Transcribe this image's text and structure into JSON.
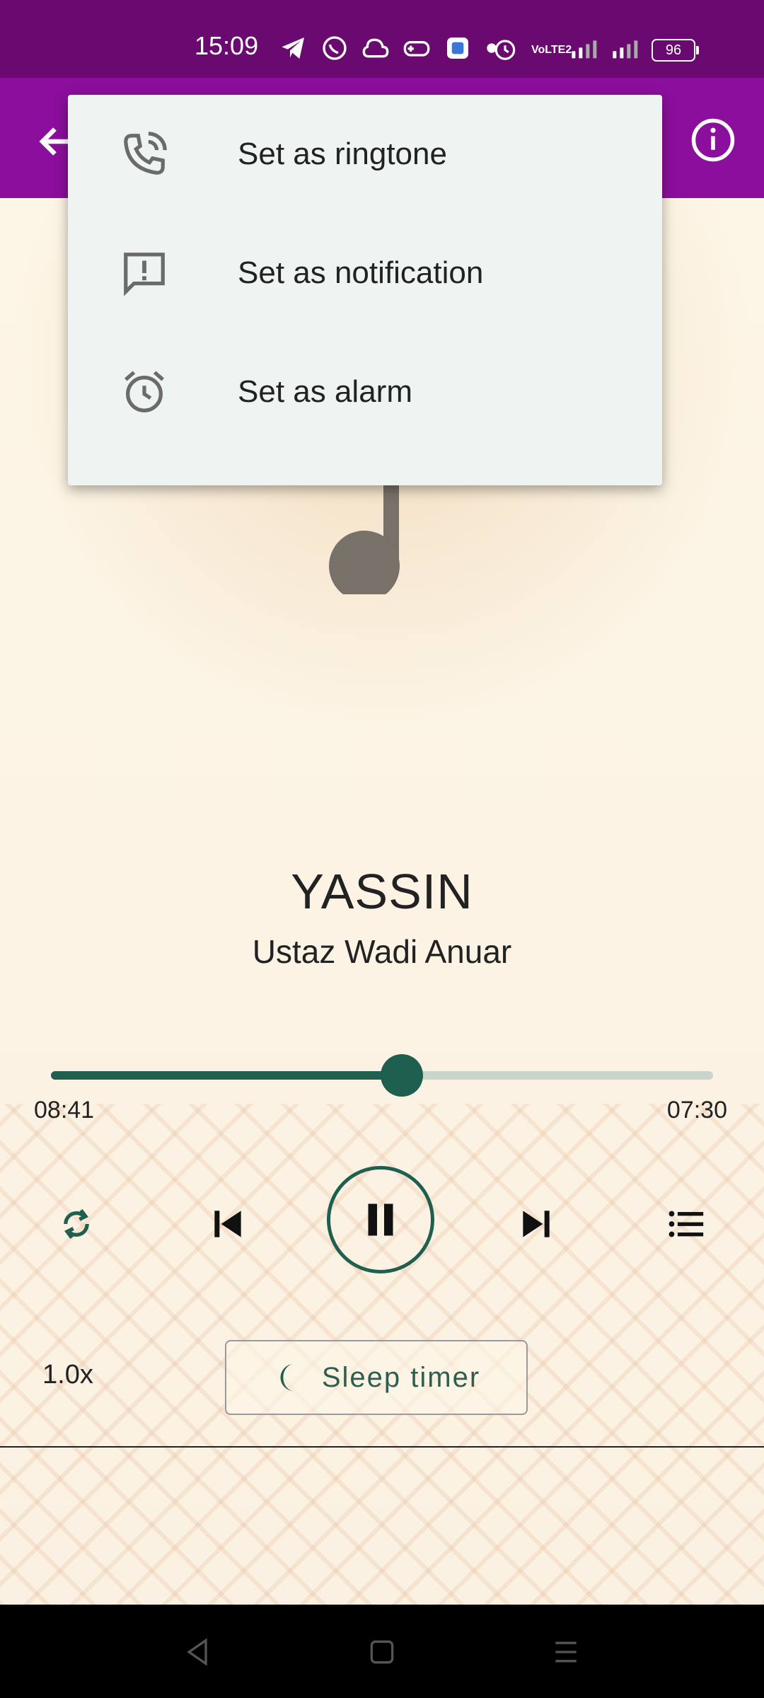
{
  "status_bar": {
    "time": "15:09",
    "battery": "96",
    "network_label": "VoLTE2"
  },
  "track": {
    "title": "YASSIN",
    "artist": "Ustaz Wadi Anuar"
  },
  "seek": {
    "elapsed": "08:41",
    "total": "07:30",
    "progress_fraction": 0.53
  },
  "controls": {
    "speed": "1.0x",
    "sleep_timer_label": "Sleep timer"
  },
  "menu": {
    "items": [
      {
        "label": "Set as ringtone",
        "icon": "phone-ring-icon"
      },
      {
        "label": "Set as notification",
        "icon": "notification-message-icon"
      },
      {
        "label": "Set as alarm",
        "icon": "alarm-clock-icon"
      }
    ]
  },
  "colors": {
    "status_bar": "#6a0a70",
    "app_bar": "#8b0f9c",
    "accent": "#1f5f50",
    "menu_bg": "#eef4f2",
    "page_bg": "#fdf5e6"
  }
}
